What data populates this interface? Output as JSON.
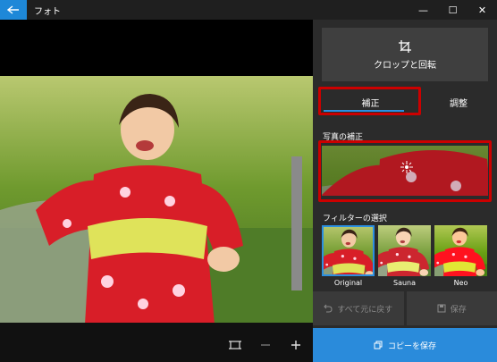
{
  "app": {
    "title": "フォト"
  },
  "window": {
    "minimize": "—",
    "maximize": "☐",
    "close": "✕"
  },
  "panel": {
    "crop_label": "クロップと回転",
    "tabs": [
      {
        "label": "補正"
      },
      {
        "label": "調整"
      }
    ],
    "enhance_title": "写真の補正",
    "filter_title": "フィルターの選択",
    "filters": [
      {
        "label": "Original"
      },
      {
        "label": "Sauna"
      },
      {
        "label": "Neo"
      }
    ],
    "undo_all": "すべて元に戻す",
    "save": "保存",
    "save_copy": "コピーを保存"
  },
  "icons": {
    "back": "arrow-left-icon",
    "crop": "crop-rotate-icon",
    "fit": "fit-to-window-icon",
    "zoom_out": "zoom-out-icon",
    "zoom_in": "zoom-in-icon"
  },
  "colors": {
    "accent": "#2a8bdb",
    "highlight": "#cc0000"
  }
}
